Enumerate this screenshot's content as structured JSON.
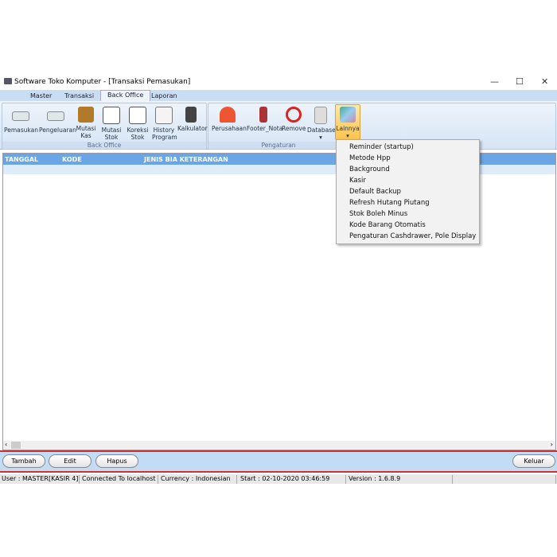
{
  "window": {
    "title": "Software Toko Komputer - [Transaksi Pemasukan]",
    "minimize": "—",
    "maximize": "☐",
    "close": "✕"
  },
  "tabs": [
    "Master",
    "Transaksi",
    "Back Office",
    "Laporan"
  ],
  "ribbon": {
    "back_office": {
      "label": "Back Office",
      "buttons": [
        [
          "Pemasukan",
          ""
        ],
        [
          "Pengeluaran",
          ""
        ],
        [
          "Mutasi",
          "Kas"
        ],
        [
          "Mutasi",
          "Stok"
        ],
        [
          "Koreksi",
          "Stok"
        ],
        [
          "History",
          "Program"
        ],
        [
          "Kalkulator",
          ""
        ]
      ]
    },
    "pengaturan": {
      "label": "Pengaturan",
      "buttons": [
        "Perusahaan",
        "Footer_Nota",
        "Remove",
        "Database",
        "Lainnya"
      ]
    },
    "dropdown_arrow": "▾"
  },
  "grid": {
    "columns": [
      "TANGGAL",
      "KODE",
      "JENIS BIA KETERANGAN"
    ],
    "scroll_left": "‹",
    "scroll_right": "›"
  },
  "menu": [
    "Reminder (startup)",
    "Metode Hpp",
    "Background",
    "Kasir",
    "Default Backup",
    "Refresh Hutang Piutang",
    "Stok Boleh Minus",
    "Kode Barang Otomatis",
    "Pengaturan Cashdrawer, Pole Display"
  ],
  "actions": {
    "tambah": "Tambah",
    "edit": "Edit",
    "hapus": "Hapus",
    "keluar": "Keluar"
  },
  "status": [
    "User : MASTER[KASIR 4]",
    "Connected To localhost",
    "Currency : Indonesian",
    "Start  : 02-10-2020 03:46:59",
    "Version : 1.6.8.9"
  ]
}
